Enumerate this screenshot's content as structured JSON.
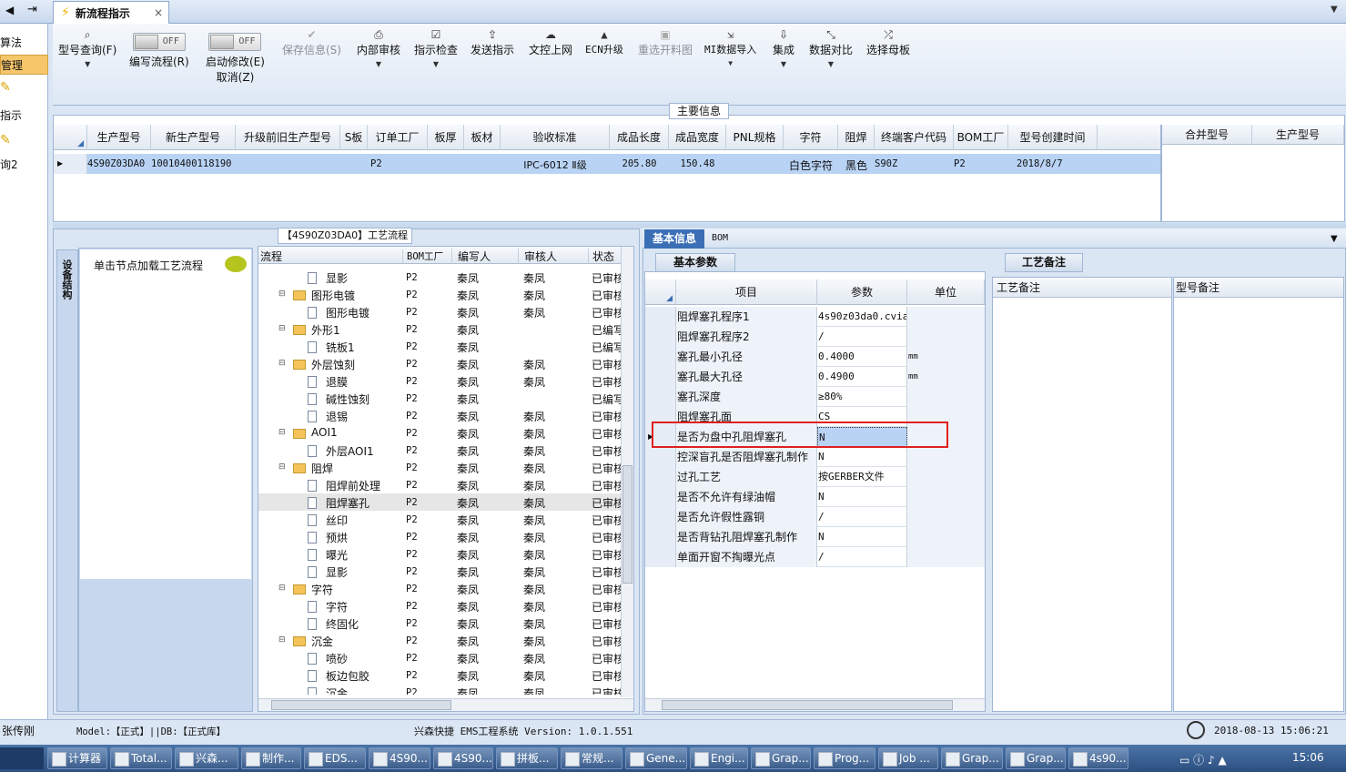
{
  "left_nav": {
    "items": [
      "算法",
      "管理",
      "指示",
      "询2"
    ]
  },
  "doc_tab": {
    "title": "新流程指示",
    "close": "×"
  },
  "toolbar": {
    "model_query": "型号查询(F)",
    "edit_flow": "编写流程(R)",
    "edit_flow_toggle": "OFF",
    "start_modify": "启动修改(E)",
    "start_modify_toggle": "OFF",
    "cancel": "取消(Z)",
    "save_info": "保存信息(S)",
    "internal_review": "内部审核",
    "check_instruction": "指示检查",
    "send_instruction": "发送指示",
    "upload_doc": "文控上网",
    "ecn_upgrade": "ECN升级",
    "reselect_drawing": "重选开料图",
    "mi_import": "MI数据导入",
    "integrate": "集成",
    "compare": "数据对比",
    "select_master": "选择母板"
  },
  "main_info": {
    "title": "主要信息",
    "columns": [
      "生产型号",
      "新生产型号",
      "升级前旧生产型号",
      "S板",
      "订单工厂",
      "板厚",
      "板材",
      "验收标准",
      "成品长度",
      "成品宽度",
      "PNL规格",
      "字符",
      "阻焊",
      "终端客户代码",
      "BOM工厂",
      "型号创建时间"
    ],
    "row": [
      "4S90Z03DA0",
      "10010400118190",
      "",
      "",
      "P2",
      "",
      "",
      "IPC-6012 Ⅱ级",
      "205.80",
      "150.48",
      "",
      "白色字符",
      "黑色",
      "S90Z",
      "P2",
      "2018/8/7"
    ],
    "right_columns": [
      "合并型号",
      "生产型号"
    ]
  },
  "flow": {
    "title": "【4S90Z03DA0】工艺流程",
    "side_tab": "设备结构",
    "hint": "单击节点加载工艺流程",
    "columns": [
      "流程",
      "BOM工厂",
      "编写人",
      "审核人",
      "状态"
    ],
    "rows": [
      {
        "name": "显影",
        "level": 2,
        "bom": "P2",
        "writer": "秦凤",
        "reviewer": "秦凤",
        "status": "已审核"
      },
      {
        "name": "图形电镀",
        "level": 1,
        "bom": "P2",
        "writer": "秦凤",
        "reviewer": "秦凤",
        "status": "已审核"
      },
      {
        "name": "图形电镀",
        "level": 2,
        "bom": "P2",
        "writer": "秦凤",
        "reviewer": "秦凤",
        "status": "已审核"
      },
      {
        "name": "外形1",
        "level": 1,
        "bom": "P2",
        "writer": "秦凤",
        "reviewer": "",
        "status": "已编写"
      },
      {
        "name": "铣板1",
        "level": 2,
        "bom": "P2",
        "writer": "秦凤",
        "reviewer": "",
        "status": "已编写"
      },
      {
        "name": "外层蚀刻",
        "level": 1,
        "bom": "P2",
        "writer": "秦凤",
        "reviewer": "秦凤",
        "status": "已审核"
      },
      {
        "name": "退膜",
        "level": 2,
        "bom": "P2",
        "writer": "秦凤",
        "reviewer": "秦凤",
        "status": "已审核"
      },
      {
        "name": "碱性蚀刻",
        "level": 2,
        "bom": "P2",
        "writer": "秦凤",
        "reviewer": "",
        "status": "已编写"
      },
      {
        "name": "退锡",
        "level": 2,
        "bom": "P2",
        "writer": "秦凤",
        "reviewer": "秦凤",
        "status": "已审核"
      },
      {
        "name": "AOI1",
        "level": 1,
        "bom": "P2",
        "writer": "秦凤",
        "reviewer": "秦凤",
        "status": "已审核"
      },
      {
        "name": "外层AOI1",
        "level": 2,
        "bom": "P2",
        "writer": "秦凤",
        "reviewer": "秦凤",
        "status": "已审核"
      },
      {
        "name": "阻焊",
        "level": 1,
        "bom": "P2",
        "writer": "秦凤",
        "reviewer": "秦凤",
        "status": "已审核"
      },
      {
        "name": "阻焊前处理",
        "level": 2,
        "bom": "P2",
        "writer": "秦凤",
        "reviewer": "秦凤",
        "status": "已审核"
      },
      {
        "name": "阻焊塞孔",
        "level": 2,
        "bom": "P2",
        "writer": "秦凤",
        "reviewer": "秦凤",
        "status": "已审核",
        "selected": true
      },
      {
        "name": "丝印",
        "level": 2,
        "bom": "P2",
        "writer": "秦凤",
        "reviewer": "秦凤",
        "status": "已审核"
      },
      {
        "name": "预烘",
        "level": 2,
        "bom": "P2",
        "writer": "秦凤",
        "reviewer": "秦凤",
        "status": "已审核"
      },
      {
        "name": "曝光",
        "level": 2,
        "bom": "P2",
        "writer": "秦凤",
        "reviewer": "秦凤",
        "status": "已审核"
      },
      {
        "name": "显影",
        "level": 2,
        "bom": "P2",
        "writer": "秦凤",
        "reviewer": "秦凤",
        "status": "已审核"
      },
      {
        "name": "字符",
        "level": 1,
        "bom": "P2",
        "writer": "秦凤",
        "reviewer": "秦凤",
        "status": "已审核"
      },
      {
        "name": "字符",
        "level": 2,
        "bom": "P2",
        "writer": "秦凤",
        "reviewer": "秦凤",
        "status": "已审核"
      },
      {
        "name": "终固化",
        "level": 2,
        "bom": "P2",
        "writer": "秦凤",
        "reviewer": "秦凤",
        "status": "已审核"
      },
      {
        "name": "沉金",
        "level": 1,
        "bom": "P2",
        "writer": "秦凤",
        "reviewer": "秦凤",
        "status": "已审核"
      },
      {
        "name": "喷砂",
        "level": 2,
        "bom": "P2",
        "writer": "秦凤",
        "reviewer": "秦凤",
        "status": "已审核"
      },
      {
        "name": "板边包胶",
        "level": 2,
        "bom": "P2",
        "writer": "秦凤",
        "reviewer": "秦凤",
        "status": "已审核"
      },
      {
        "name": "沉金",
        "level": 2,
        "bom": "P2",
        "writer": "秦凤",
        "reviewer": "秦凤",
        "status": "已审核"
      }
    ]
  },
  "details": {
    "tab_basic": "基本信息",
    "tab_bom": "BOM",
    "subtab": "基本参数",
    "columns": [
      "项目",
      "参数",
      "单位"
    ],
    "rows": [
      {
        "item": "阻焊塞孔程序1",
        "param": "4s90z03da0.cvia",
        "unit": ""
      },
      {
        "item": "阻焊塞孔程序2",
        "param": "/",
        "unit": ""
      },
      {
        "item": "塞孔最小孔径",
        "param": "0.4000",
        "unit": "mm"
      },
      {
        "item": "塞孔最大孔径",
        "param": "0.4900",
        "unit": "mm"
      },
      {
        "item": "塞孔深度",
        "param": "≥80%",
        "unit": ""
      },
      {
        "item": "阻焊塞孔面",
        "param": "CS",
        "unit": ""
      },
      {
        "item": "是否为盘中孔阻焊塞孔",
        "param": "N",
        "unit": "",
        "highlight": true
      },
      {
        "item": "控深盲孔是否阻焊塞孔制作",
        "param": "N",
        "unit": ""
      },
      {
        "item": "过孔工艺",
        "param": "按GERBER文件",
        "unit": ""
      },
      {
        "item": "是否不允许有绿油帽",
        "param": "N",
        "unit": ""
      },
      {
        "item": "是否允许假性露铜",
        "param": "/",
        "unit": ""
      },
      {
        "item": "是否背钻孔阻焊塞孔制作",
        "param": "N",
        "unit": ""
      },
      {
        "item": "单面开窗不掏曝光点",
        "param": "/",
        "unit": ""
      }
    ],
    "remarks_tab": "工艺备注",
    "remark_col1": "工艺备注",
    "remark_col2": "型号备注"
  },
  "status_bar": {
    "user": "张传刚",
    "model": "Model:【正式】||DB:【正式库】",
    "app": "兴森快捷 EMS工程系统 Version: 1.0.1.551",
    "datetime": "2018-08-13 15:06:21"
  },
  "taskbar": {
    "items": [
      "计算器",
      "Total...",
      "兴森...",
      "制作...",
      "EDS...",
      "4S90...",
      "4S90...",
      "拼板...",
      "常规...",
      "Gene...",
      "Engi...",
      "Grap...",
      "Prog...",
      "Job ...",
      "Grap...",
      "Grap...",
      "4s90..."
    ],
    "clock": "15:06"
  },
  "colors": {
    "accent": "#3b6fb5",
    "highlight_box": "#e02020",
    "selected_row": "#b9d3f5",
    "taskbar": "#2c4f80"
  }
}
